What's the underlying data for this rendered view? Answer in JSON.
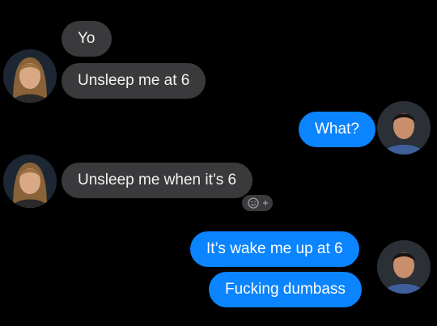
{
  "thread": {
    "messages": [
      {
        "sender": "them",
        "text": "Yo"
      },
      {
        "sender": "them",
        "text": "Unsleep me at 6"
      },
      {
        "sender": "me",
        "text": "What?"
      },
      {
        "sender": "them",
        "text": "Unsleep me when it’s 6"
      },
      {
        "sender": "me",
        "text": "It’s wake me up at 6"
      },
      {
        "sender": "me",
        "text": "Fucking dumbass"
      }
    ]
  },
  "colors": {
    "background": "#000000",
    "incoming_bubble": "#3a3a3c",
    "outgoing_bubble": "#0a84ff",
    "text": "#ffffff"
  },
  "icons": {
    "reaction": "add-reaction-icon"
  }
}
